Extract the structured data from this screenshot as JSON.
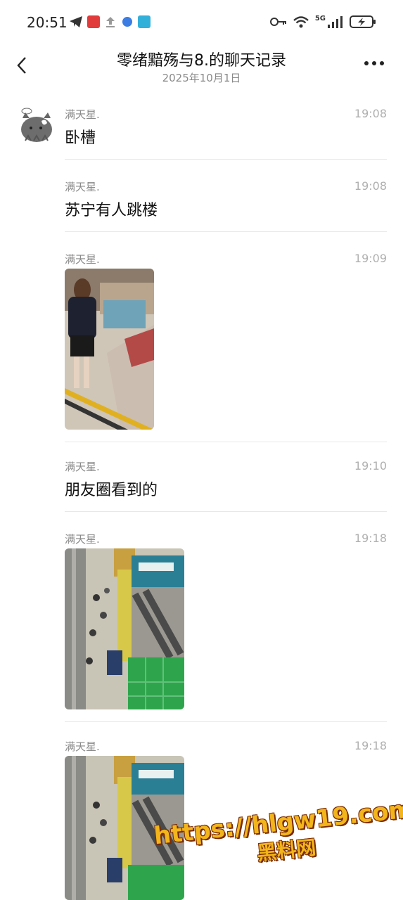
{
  "status_bar": {
    "time": "20:51",
    "network": "5G",
    "icons": [
      "telegram-icon",
      "app-badge-icon",
      "upload-icon",
      "browser-icon",
      "reader-icon",
      "key-icon",
      "wifi-icon",
      "signal-icon",
      "battery-icon"
    ]
  },
  "header": {
    "title": "零绪黯殇与8.的聊天记录",
    "date": "2025年10月1日"
  },
  "messages": [
    {
      "sender": "满天星.",
      "time": "19:08",
      "text": "卧槽"
    },
    {
      "sender": "满天星.",
      "time": "19:08",
      "text": "苏宁有人跳楼"
    },
    {
      "sender": "满天星.",
      "time": "19:09",
      "image": "photo-person-at-counter"
    },
    {
      "sender": "满天星.",
      "time": "19:10",
      "text": "朋友圈看到的"
    },
    {
      "sender": "满天星.",
      "time": "19:18",
      "image": "photo-mall-escalator"
    },
    {
      "sender": "满天星.",
      "time": "19:18",
      "image": "photo-mall-escalator"
    }
  ],
  "watermark": {
    "url": "https://hlgw19.com",
    "label": "黑料网"
  },
  "colors": {
    "text": "#111111",
    "secondary": "#8a8a8a",
    "time": "#b0b0b0",
    "divider": "#e8e8e8",
    "watermark": "#f3b51c"
  }
}
